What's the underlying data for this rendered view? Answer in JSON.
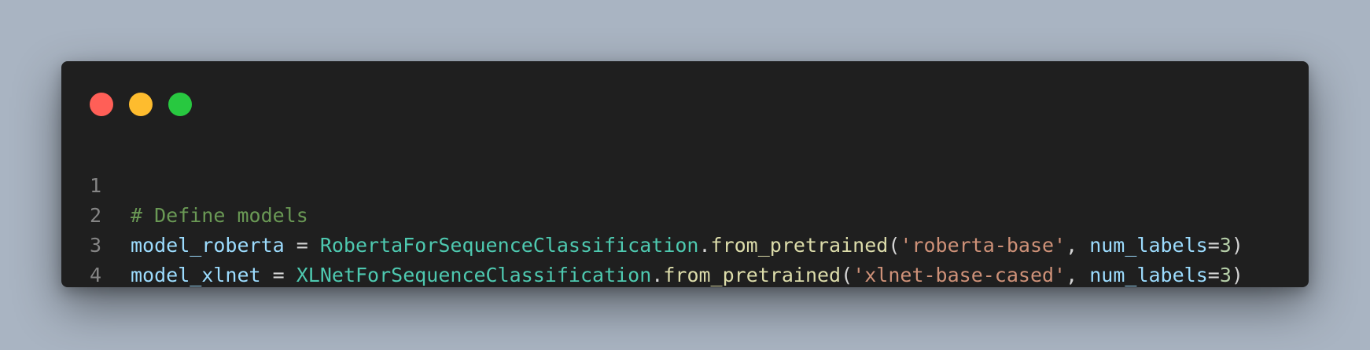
{
  "colors": {
    "background": "#a9b4c2",
    "window": "#1f1f1f",
    "close": "#ff5f57",
    "minimize": "#febc2e",
    "zoom": "#28c840",
    "comment": "#6a9955",
    "variable": "#9cdcfe",
    "class": "#4ec9b0",
    "function": "#dcdcaa",
    "string": "#ce9178",
    "number": "#b5cea8",
    "line_number": "#858585"
  },
  "editor": {
    "line_numbers": [
      "1",
      "2",
      "3",
      "4"
    ],
    "lines": [
      {
        "comment": "# Define models"
      },
      {
        "var": "model_roberta",
        "eq": " = ",
        "cls": "RobertaForSequenceClassification",
        "dot": ".",
        "func": "from_pretrained",
        "open": "(",
        "str": "'roberta-base'",
        "comma": ", ",
        "kw": "num_labels",
        "kweq": "=",
        "num": "3",
        "close": ")"
      },
      {
        "var": "model_xlnet",
        "eq": " = ",
        "cls": "XLNetForSequenceClassification",
        "dot": ".",
        "func": "from_pretrained",
        "open": "(",
        "str": "'xlnet-base-cased'",
        "comma": ", ",
        "kw": "num_labels",
        "kweq": "=",
        "num": "3",
        "close": ")"
      },
      {
        "text": ""
      }
    ]
  }
}
